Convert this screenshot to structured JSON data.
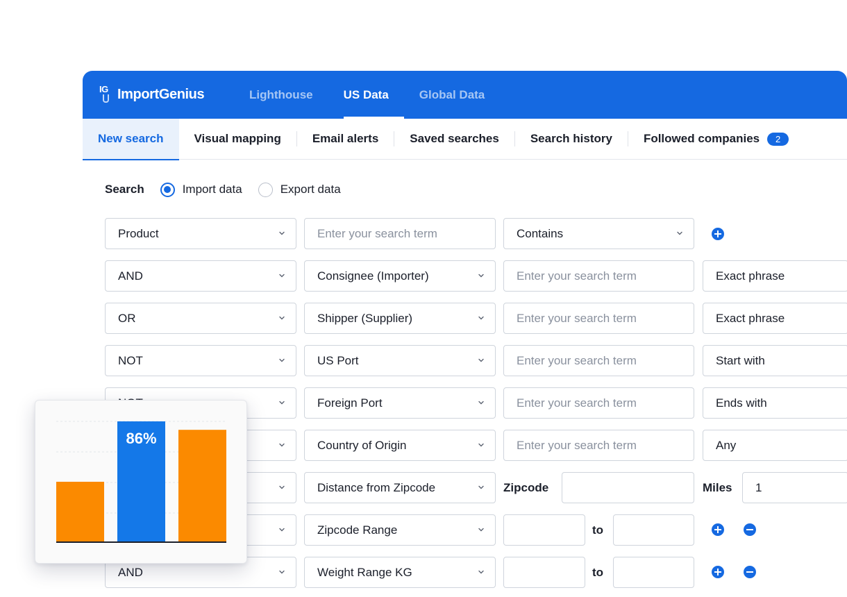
{
  "brand": {
    "logo_mark": "IG",
    "name": "ImportGenius"
  },
  "main_nav": [
    {
      "label": "Lighthouse",
      "active": false
    },
    {
      "label": "US Data",
      "active": true
    },
    {
      "label": "Global Data",
      "active": false
    }
  ],
  "sub_nav": [
    {
      "label": "New search",
      "active": true
    },
    {
      "label": "Visual mapping",
      "active": false
    },
    {
      "label": "Email alerts",
      "active": false
    },
    {
      "label": "Saved searches",
      "active": false
    },
    {
      "label": "Search history",
      "active": false
    },
    {
      "label": "Followed companies",
      "active": false,
      "badge": "2"
    }
  ],
  "search_type": {
    "label": "Search",
    "options": [
      {
        "label": "Import data",
        "checked": true
      },
      {
        "label": "Export data",
        "checked": false
      }
    ]
  },
  "rows": [
    {
      "operator": "Product",
      "field": "",
      "term_placeholder": "Enter your search term",
      "match": "Contains"
    },
    {
      "operator": "AND",
      "field": "Consignee (Importer)",
      "term_placeholder": "Enter your search term",
      "match": "Exact phrase"
    },
    {
      "operator": "OR",
      "field": "Shipper (Supplier)",
      "term_placeholder": "Enter your search term",
      "match": "Exact phrase"
    },
    {
      "operator": "NOT",
      "field": "US Port",
      "term_placeholder": "Enter your search term",
      "match": "Start with"
    },
    {
      "operator": "NOT",
      "field": "Foreign Port",
      "term_placeholder": "Enter your search term",
      "match": "Ends with"
    },
    {
      "operator": "",
      "field": "Country of Origin",
      "term_placeholder": "Enter your search term",
      "match": "Any"
    },
    {
      "operator": "",
      "field": "Distance from Zipcode",
      "zipcode_label": "Zipcode",
      "zipcode_value": "",
      "miles_label": "Miles",
      "miles_value": "1"
    },
    {
      "operator": "",
      "field": "Zipcode Range",
      "from_value": "",
      "to_label": "to",
      "to_value": ""
    },
    {
      "operator": "AND",
      "field": "Weight Range KG",
      "from_value": "",
      "to_label": "to",
      "to_value": ""
    }
  ],
  "icons": {
    "chevron": "chevron-down-icon",
    "add": "plus-circle-icon",
    "remove": "minus-circle-icon"
  },
  "colors": {
    "brand_blue": "#1569e1",
    "bar_orange": "#fb8a00",
    "bar_blue": "#1478e8"
  },
  "chart_data": {
    "type": "bar",
    "categories": [
      "",
      "",
      ""
    ],
    "values": [
      50,
      100,
      93
    ],
    "bar_colors": [
      "#fb8a00",
      "#1478e8",
      "#fb8a00"
    ],
    "labels": [
      "",
      "86%",
      ""
    ],
    "ylim": [
      0,
      100
    ],
    "grid": true,
    "title": "",
    "xlabel": "",
    "ylabel": ""
  }
}
